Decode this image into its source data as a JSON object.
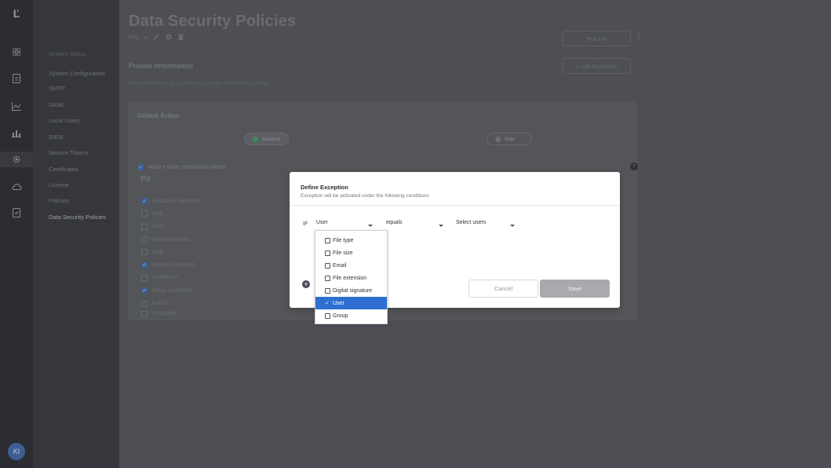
{
  "rail": {
    "logo": "Ľ",
    "icons": [
      {
        "name": "grid-icon",
        "glyph": "▦"
      },
      {
        "name": "document-icon",
        "glyph": "▣"
      },
      {
        "name": "analytics-icon",
        "glyph": "⌞"
      },
      {
        "name": "chart-icon",
        "glyph": "▙"
      },
      {
        "name": "settings-icon",
        "glyph": "⚙"
      },
      {
        "name": "cloud-icon",
        "glyph": "☁"
      },
      {
        "name": "policy-icon",
        "glyph": "▤"
      }
    ],
    "avatar": "KI"
  },
  "sidenav": {
    "header": "System Setup",
    "items": [
      "System Configuration",
      "SMTP",
      "SAML",
      "Local Users",
      "SIEM",
      "Service Tokens",
      "Certificates",
      "License",
      "Policies",
      "Data Security Policies"
    ]
  },
  "page": {
    "title": "Data Security Policies",
    "rule_label": "Ring",
    "test_file": "Test File",
    "add_exception": "+ Add Exception",
    "section_title": "Private Information",
    "section_sub": "Select whether to analyze files for private information violation"
  },
  "card": {
    "default_action": "Default Action",
    "analyze": "Analyze",
    "skip": "Skip",
    "mask_label": "Mask Private Information (Beta)",
    "pii_title": "PII",
    "pii_items": [
      {
        "label": "ACCOUNT NUMBER",
        "checked": true
      },
      {
        "label": "AGE",
        "checked": false
      },
      {
        "label": "DATE",
        "checked": false
      },
      {
        "label": "DATE INTERVAL",
        "checked": false
      },
      {
        "label": "DOB",
        "checked": false
      },
      {
        "label": "DRIVER LICENSE",
        "checked": true
      },
      {
        "label": "DURATION",
        "checked": false
      },
      {
        "label": "EMAIL ADDRESS",
        "checked": true
      },
      {
        "label": "EVENT",
        "checked": false
      },
      {
        "label": "FILENAME",
        "checked": false
      }
    ]
  },
  "dialog": {
    "title": "Define Exception",
    "subtitle": "Exception will be activated under the following conditions",
    "if_label": "IF",
    "field_select": "User",
    "operator_select": "equals",
    "value_select": "Select users",
    "cancel": "Cancel",
    "save": "Save",
    "dropdown": [
      {
        "label": "File type",
        "selected": false
      },
      {
        "label": "File size",
        "selected": false
      },
      {
        "label": "Email",
        "selected": false
      },
      {
        "label": "File extension",
        "selected": false
      },
      {
        "label": "Digital signature",
        "selected": false
      },
      {
        "label": "User",
        "selected": true
      },
      {
        "label": "Group",
        "selected": false
      }
    ]
  }
}
